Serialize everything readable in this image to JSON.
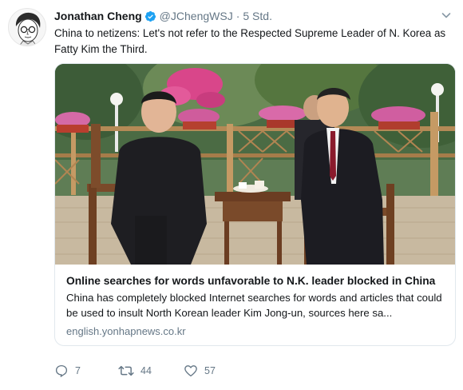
{
  "author": {
    "name": "Jonathan Cheng",
    "handle": "@JChengWSJ",
    "separator": "·",
    "time": "5 Std."
  },
  "tweet": {
    "text": "China to netizens: Let's not refer to the Respected Supreme Leader of N. Korea as\nFatty Kim the Third."
  },
  "card": {
    "title": "Online searches for words unfavorable to N.K. leader blocked in China",
    "description": "China has completely blocked Internet searches for words and articles that could be used to insult North Korean leader Kim Jong-un, sources here sa...",
    "domain": "english.yonhapnews.co.kr"
  },
  "actions": {
    "reply_count": "7",
    "retweet_count": "44",
    "like_count": "57"
  },
  "colors": {
    "verified": "#1da1f2",
    "muted": "#657786",
    "border": "#e1e8ed"
  },
  "icons": [
    "avatar-sketch",
    "verified-badge-icon",
    "chevron-down-icon",
    "reply-icon",
    "retweet-icon",
    "heart-icon"
  ]
}
